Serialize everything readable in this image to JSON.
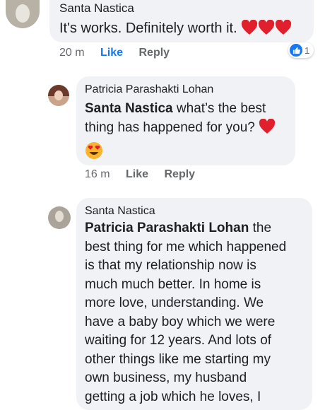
{
  "comments": [
    {
      "author": "Santa Nastica",
      "text": "It's works. Definitely worth it.",
      "emoji": [
        "red-heart-icon",
        "red-heart-icon",
        "red-heart-icon"
      ],
      "time": "20 m",
      "like": "Like",
      "reply": "Reply",
      "reaction_count": "1"
    },
    {
      "author": "Patricia Parashakti Lohan",
      "mention": "Santa Nastica",
      "text_lines": [
        "what’s the best",
        "thing has happened for you?"
      ],
      "emoji": [
        "red-heart-icon",
        "heart-eyes-icon"
      ],
      "time": "16 m",
      "like": "Like",
      "reply": "Reply"
    },
    {
      "author": "Santa Nastica",
      "mention": "Patricia Parashakti Lohan",
      "text_lines": [
        "the",
        "best thing for me which happened",
        "is that my relationship now is",
        "much much better. In home is",
        "more love, understanding. We",
        "have a baby boy which we were",
        "waiting for 12 years. And lots of",
        "other things like me starting my",
        "own business, my husband",
        "getting a job which he loves, I"
      ]
    }
  ],
  "colors": {
    "bubble": "#f0f2f5",
    "meta_text": "#65676b",
    "heart": "#e0202d",
    "like_blue": "#1877f2"
  }
}
